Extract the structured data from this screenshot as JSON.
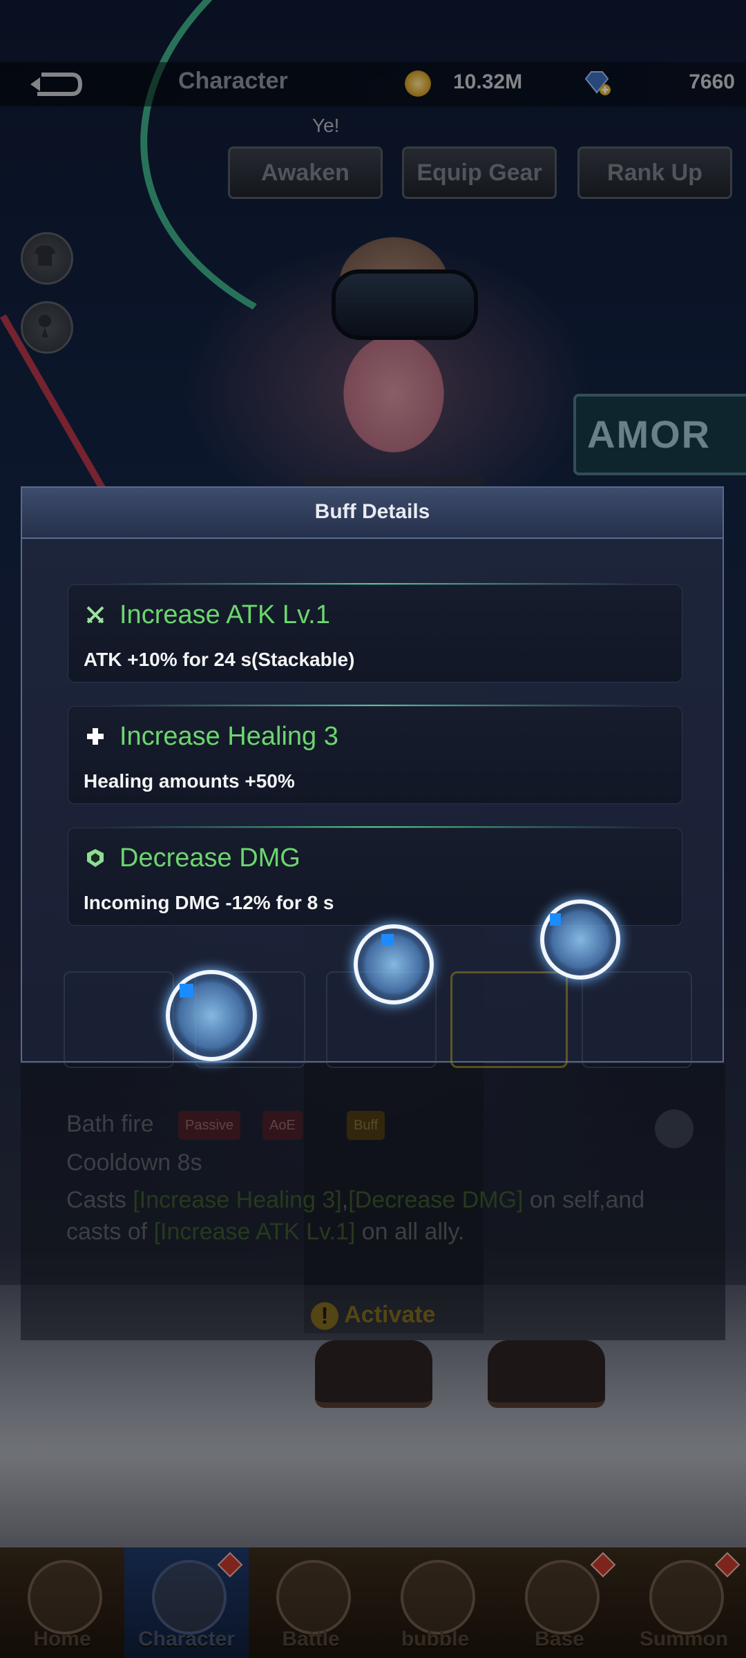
{
  "topbar": {
    "title": "Character",
    "coins": "10.32M",
    "gems": "7660",
    "cheer_text": "Ye!"
  },
  "action_buttons": {
    "awaken": "Awaken",
    "equip_gear": "Equip Gear",
    "rank_up": "Rank Up"
  },
  "skill_panel": {
    "skill_name": "Bath fire",
    "tags": [
      "Passive",
      "AoE",
      "Buff"
    ],
    "cooldown": "Cooldown 8s",
    "desc_part1": "Casts ",
    "desc_hl1": "[Increase Healing 3]",
    "desc_sep": ",",
    "desc_hl2": "[Decrease DMG]",
    "desc_part2": " on self,and casts of ",
    "desc_hl3": "[Increase ATK Lv.1]",
    "desc_part3": " on all ally.",
    "activate": "Activate"
  },
  "scene": {
    "sign_text": "AMOR"
  },
  "modal": {
    "title": "Buff Details",
    "buffs": [
      {
        "name": "Increase ATK Lv.1",
        "desc": "ATK +10% for 24 s(Stackable)",
        "icon": "swords-icon"
      },
      {
        "name": "Increase Healing 3",
        "desc": "Healing amounts +50%",
        "icon": "heal-cross-icon"
      },
      {
        "name": "Decrease DMG",
        "desc": "Incoming DMG -12% for 8 s",
        "icon": "shield-icon"
      }
    ]
  },
  "bottom_nav": {
    "items": [
      {
        "label": "Home",
        "icon": "home-icon"
      },
      {
        "label": "Character",
        "icon": "character-icon"
      },
      {
        "label": "Battle",
        "icon": "battle-icon"
      },
      {
        "label": "bubble",
        "icon": "bubble-icon"
      },
      {
        "label": "Base",
        "icon": "base-icon"
      },
      {
        "label": "Summon",
        "icon": "summon-icon"
      }
    ],
    "active_index": 1
  },
  "colors": {
    "buff_name": "#6cd66f",
    "accent_glow": "#5adc96",
    "touch_indicator": "#1b8cff"
  }
}
